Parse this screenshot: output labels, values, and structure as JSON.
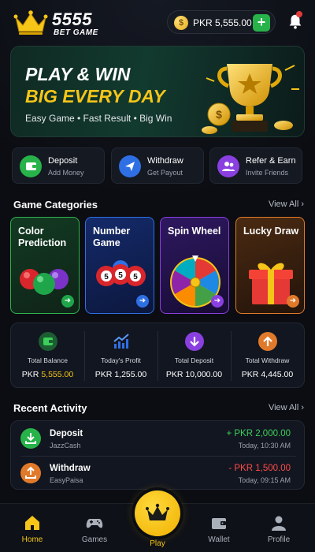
{
  "header": {
    "logo_number": "5555",
    "logo_sub": "BET GAME",
    "balance": "PKR 5,555.00",
    "add_label": "+"
  },
  "banner": {
    "title_line1": "PLAY & WIN",
    "title_line2": "BIG EVERY DAY",
    "subtitle": "Easy Game • Fast Result • Big Win"
  },
  "quick_actions": [
    {
      "title": "Deposit",
      "sub": "Add Money",
      "icon": "wallet-icon",
      "color": "#27b34a"
    },
    {
      "title": "Withdraw",
      "sub": "Get Payout",
      "icon": "send-icon",
      "color": "#2f6fe4"
    },
    {
      "title": "Refer & Earn",
      "sub": "Invite Friends",
      "icon": "users-icon",
      "color": "#8a3fe0"
    }
  ],
  "categories": {
    "title": "Game Categories",
    "view_all": "View All ›",
    "games": [
      {
        "title": "Color Prediction",
        "icon": "color-balls-icon",
        "color": "#2fb34e"
      },
      {
        "title": "Number Game",
        "icon": "lottery-balls-icon",
        "color": "#2f6fe4"
      },
      {
        "title": "Spin Wheel",
        "icon": "spin-wheel-icon",
        "color": "#8a3fe0"
      },
      {
        "title": "Lucky Draw",
        "icon": "gift-box-icon",
        "color": "#e07a2a"
      }
    ]
  },
  "stats": [
    {
      "label": "Total Balance",
      "value_prefix": "PKR ",
      "value_main": "5,555.00",
      "icon": "wallet-icon",
      "color": "#27b34a"
    },
    {
      "label": "Today's Profit",
      "value_prefix": "PKR ",
      "value_main": "1,255.00",
      "icon": "chart-up-icon",
      "color": "#2f6fe4"
    },
    {
      "label": "Total Deposit",
      "value_prefix": "PKR ",
      "value_main": "10,000.00",
      "icon": "arrow-down-icon",
      "color": "#8a3fe0"
    },
    {
      "label": "Total Withdraw",
      "value_prefix": "PKR ",
      "value_main": "4,445.00",
      "icon": "arrow-up-icon",
      "color": "#e07a2a"
    }
  ],
  "activity": {
    "title": "Recent Activity",
    "view_all": "View All ›",
    "items": [
      {
        "title": "Deposit",
        "method": "JazzCash",
        "amount": "+ PKR 2,000.00",
        "time": "Today, 10:30 AM",
        "amount_color": "#3ccf5a",
        "icon": "download-icon",
        "color": "#27b34a"
      },
      {
        "title": "Withdraw",
        "method": "EasyPaisa",
        "amount": "- PKR 1,500.00",
        "time": "Today, 09:15 AM",
        "amount_color": "#ff4a4a",
        "icon": "upload-icon",
        "color": "#e07a2a"
      }
    ]
  },
  "nav": {
    "items": [
      {
        "label": "Home",
        "icon": "home-icon",
        "active": true
      },
      {
        "label": "Games",
        "icon": "gamepad-icon",
        "active": false
      },
      {
        "label": "Play",
        "icon": "crown-icon",
        "active": false
      },
      {
        "label": "Wallet",
        "icon": "wallet-icon",
        "active": false
      },
      {
        "label": "Profile",
        "icon": "user-icon",
        "active": false
      }
    ]
  },
  "colors": {
    "accent_gold": "#f5c518",
    "positive": "#3ccf5a",
    "negative": "#ff4a4a",
    "background": "#0b0d12",
    "card": "#121620"
  }
}
